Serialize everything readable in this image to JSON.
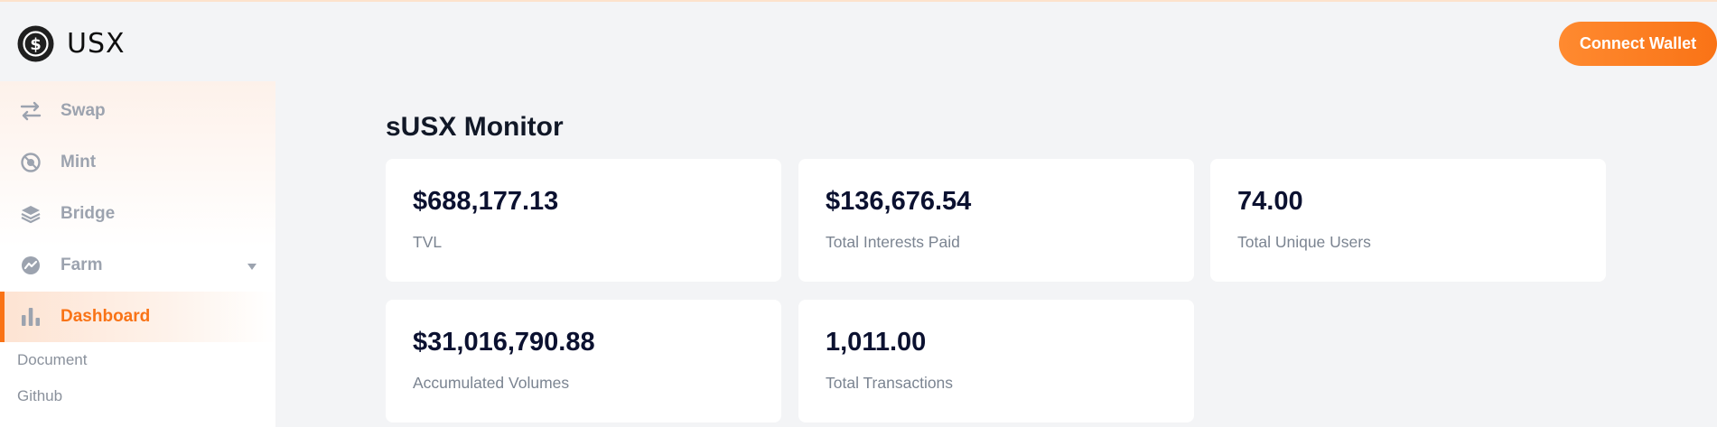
{
  "header": {
    "brand": "USX",
    "connect_label": "Connect Wallet"
  },
  "sidebar": {
    "items": [
      {
        "label": "Swap",
        "icon": "swap-icon"
      },
      {
        "label": "Mint",
        "icon": "mint-icon"
      },
      {
        "label": "Bridge",
        "icon": "bridge-icon"
      },
      {
        "label": "Farm",
        "icon": "farm-icon"
      },
      {
        "label": "Dashboard",
        "icon": "dashboard-icon",
        "active": true
      }
    ],
    "links": [
      {
        "label": "Document"
      },
      {
        "label": "Github"
      }
    ]
  },
  "main": {
    "title": "sUSX Monitor",
    "stats": [
      {
        "value": "$688,177.13",
        "label": "TVL"
      },
      {
        "value": "$136,676.54",
        "label": "Total Interests Paid"
      },
      {
        "value": "74.00",
        "label": "Total Unique Users"
      },
      {
        "value": "$31,016,790.88",
        "label": "Accumulated Volumes"
      },
      {
        "value": "1,011.00",
        "label": "Total Transactions"
      }
    ]
  },
  "colors": {
    "accent": "#f97316",
    "background": "#f3f4f6",
    "card": "#ffffff",
    "muted": "#9ca3af",
    "text_dark": "#0b1130"
  }
}
